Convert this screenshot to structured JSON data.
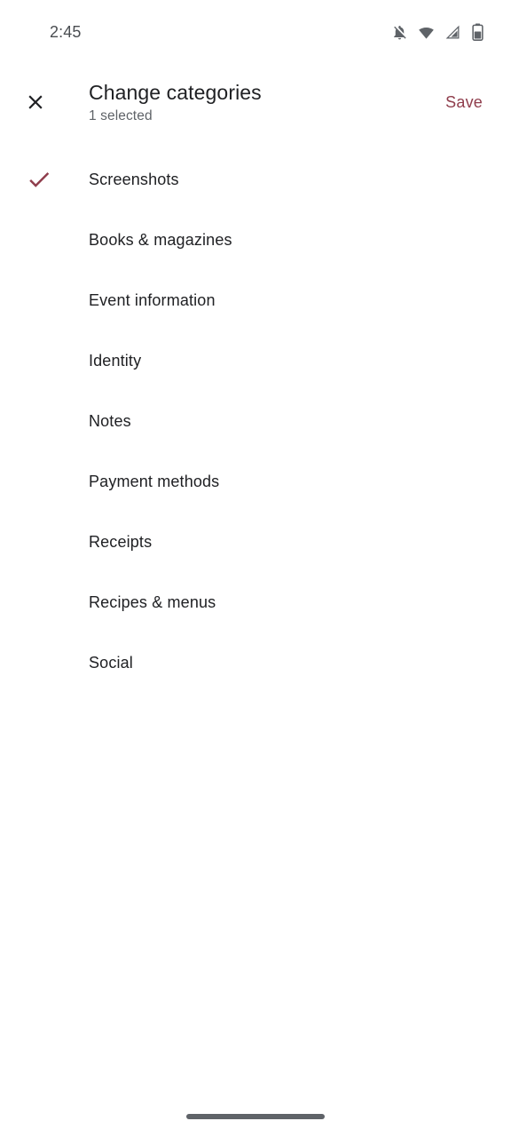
{
  "status_bar": {
    "time": "2:45",
    "icons": [
      {
        "name": "notifications-off-icon",
        "label": "Notifications off"
      },
      {
        "name": "wifi-icon",
        "label": "Wi-Fi full signal"
      },
      {
        "name": "cellular-signal-icon",
        "label": "Mobile signal"
      },
      {
        "name": "battery-icon",
        "label": "Battery"
      }
    ]
  },
  "header": {
    "close_label": "Close",
    "title": "Change categories",
    "subtitle": "1 selected",
    "save_label": "Save"
  },
  "colors": {
    "accent": "#8f3d4c",
    "text_primary": "#202124",
    "text_secondary": "#5f6368",
    "background": "#ffffff",
    "nav_pill": "#5f6368"
  },
  "categories": [
    {
      "label": "Screenshots",
      "selected": true
    },
    {
      "label": "Books & magazines",
      "selected": false
    },
    {
      "label": "Event information",
      "selected": false
    },
    {
      "label": "Identity",
      "selected": false
    },
    {
      "label": "Notes",
      "selected": false
    },
    {
      "label": "Payment methods",
      "selected": false
    },
    {
      "label": "Receipts",
      "selected": false
    },
    {
      "label": "Recipes & menus",
      "selected": false
    },
    {
      "label": "Social",
      "selected": false
    }
  ],
  "nav_bar": {
    "pill_label": "Home gesture bar"
  }
}
